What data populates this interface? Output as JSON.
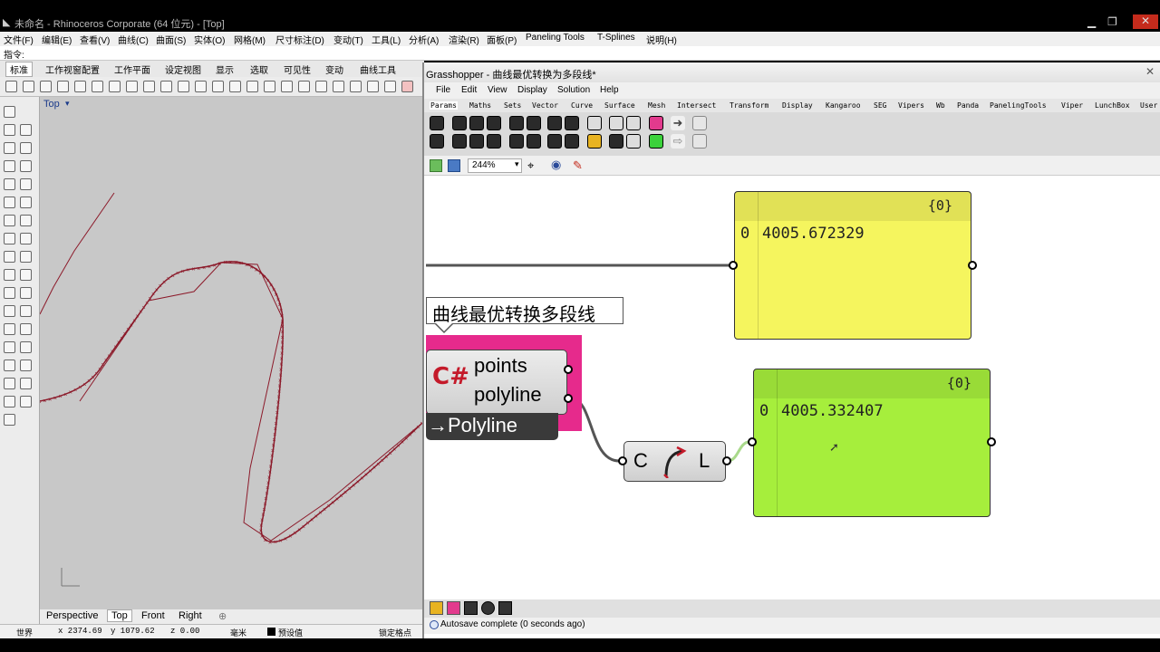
{
  "rhino": {
    "title": "未命名 - Rhinoceros Corporate (64 位元) - [Top]",
    "menu": [
      "文件(F)",
      "编辑(E)",
      "查看(V)",
      "曲线(C)",
      "曲面(S)",
      "实体(O)",
      "网格(M)",
      "尺寸标注(D)",
      "变动(T)",
      "工具(L)",
      "分析(A)",
      "渲染(R)",
      "面板(P)",
      "Paneling Tools",
      "T-Splines",
      "说明(H)"
    ],
    "command_label": "指令:",
    "tabs": [
      "标准",
      "工作视窗配置",
      "工作平面",
      "设定视图",
      "显示",
      "选取",
      "可见性",
      "变动",
      "曲线工具"
    ],
    "viewport_name": "Top",
    "viewport_tabs": [
      "Perspective",
      "Top",
      "Front",
      "Right"
    ],
    "add_tab": "⊕",
    "status": {
      "plane": "世界",
      "x": "x 2374.69",
      "y": "y 1079.62",
      "z": "z 0.00",
      "unit": "毫米",
      "layer": "预设值",
      "snap": "锁定格点"
    }
  },
  "gh": {
    "title": "Grasshopper - 曲线最优转换为多段线*",
    "menu": [
      "File",
      "Edit",
      "View",
      "Display",
      "Solution",
      "Help"
    ],
    "tabs": [
      "Params",
      "Maths",
      "Sets",
      "Vector",
      "Curve",
      "Surface",
      "Mesh",
      "Intersect",
      "Transform",
      "Display",
      "Kangaroo",
      "SEG",
      "Vipers",
      "Wb",
      "Panda",
      "PanelingTools",
      "Viper",
      "LunchBox",
      "User"
    ],
    "zoom": "244%",
    "group_title": "曲线最优转换多段线",
    "script": {
      "inputs": [
        "points",
        "polyline"
      ],
      "output": "→Polyline"
    },
    "length": {
      "in": "C",
      "out": "L"
    },
    "panel_yellow": {
      "count": "{0}",
      "index": "0",
      "value": "4005.672329",
      "color": "#f5f55e"
    },
    "panel_green": {
      "count": "{0}",
      "index": "0",
      "value": "4005.332407",
      "color": "#a6ee3c"
    },
    "status": "Autosave complete (0 seconds ago)"
  }
}
